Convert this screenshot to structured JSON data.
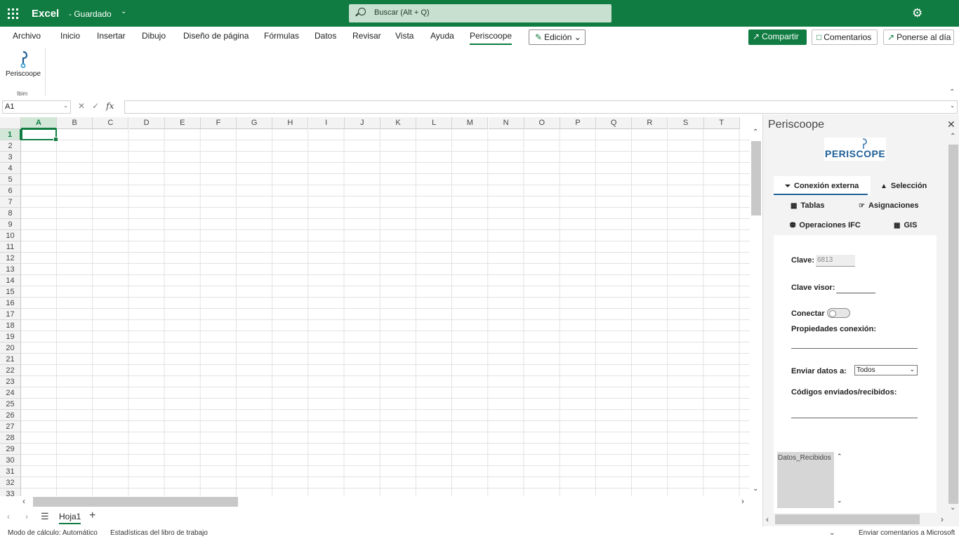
{
  "titlebar": {
    "app_name": "Excel",
    "doc_status": "- Guardado",
    "search_placeholder": "Buscar (Alt + Q)"
  },
  "menu": {
    "items": [
      "Archivo",
      "Inicio",
      "Insertar",
      "Dibujo",
      "Diseño de página",
      "Fórmulas",
      "Datos",
      "Revisar",
      "Vista",
      "Ayuda",
      "Periscoope"
    ],
    "active": "Periscoope",
    "edit_mode": "Edición",
    "share": "Compartir",
    "comments": "Comentarios",
    "catch_up": "Ponerse al día"
  },
  "ribbon": {
    "button_label": "Periscoope",
    "group_label": "Ibim"
  },
  "formula_bar": {
    "name_box": "A1",
    "formula": "",
    "fx": "fx"
  },
  "grid": {
    "columns": [
      "A",
      "B",
      "C",
      "D",
      "E",
      "F",
      "G",
      "H",
      "I",
      "J",
      "K",
      "L",
      "M",
      "N",
      "O",
      "P",
      "Q",
      "R",
      "S",
      "T"
    ],
    "rows": [
      "1",
      "2",
      "3",
      "4",
      "5",
      "6",
      "7",
      "8",
      "9",
      "10",
      "11",
      "12",
      "13",
      "14",
      "15",
      "16",
      "17",
      "18",
      "19",
      "20",
      "21",
      "22",
      "23",
      "24",
      "25",
      "26",
      "27",
      "28",
      "29",
      "30",
      "31",
      "32",
      "33"
    ],
    "selected_cell": "A1"
  },
  "sheets": {
    "tabs": [
      "Hoja1"
    ],
    "active": "Hoja1"
  },
  "statusbar": {
    "calc_mode": "Modo de cálculo: Automático",
    "stats": "Estadísticas del libro de trabajo",
    "feedback": "Enviar comentarios a Microsoft"
  },
  "pane": {
    "title": "Periscoope",
    "logo_text": "PERISCOPE",
    "tabs": [
      {
        "label": "Conexión externa",
        "icon": "plug-icon"
      },
      {
        "label": "Selección",
        "icon": "cursor-icon"
      },
      {
        "label": "Tablas",
        "icon": "table-icon"
      },
      {
        "label": "Asignaciones",
        "icon": "hand-icon"
      },
      {
        "label": "Operaciones IFC",
        "icon": "database-icon"
      },
      {
        "label": "GIS",
        "icon": "map-icon"
      }
    ],
    "active_tab": "Conexión externa",
    "form": {
      "clave_label": "Clave:",
      "clave_value": "6813",
      "clave_visor_label": "Clave visor:",
      "conectar_label": "Conectar",
      "conectar_on": false,
      "propiedades_label": "Propiedades conexión:",
      "enviar_label": "Enviar datos a:",
      "enviar_value": "Todos",
      "codigos_label": "Códigos enviados/recibidos:",
      "datos_recibidos": "Datos_Recibidos"
    }
  },
  "colors": {
    "brand": "#107c41",
    "pane_accent": "#1e5f96"
  }
}
